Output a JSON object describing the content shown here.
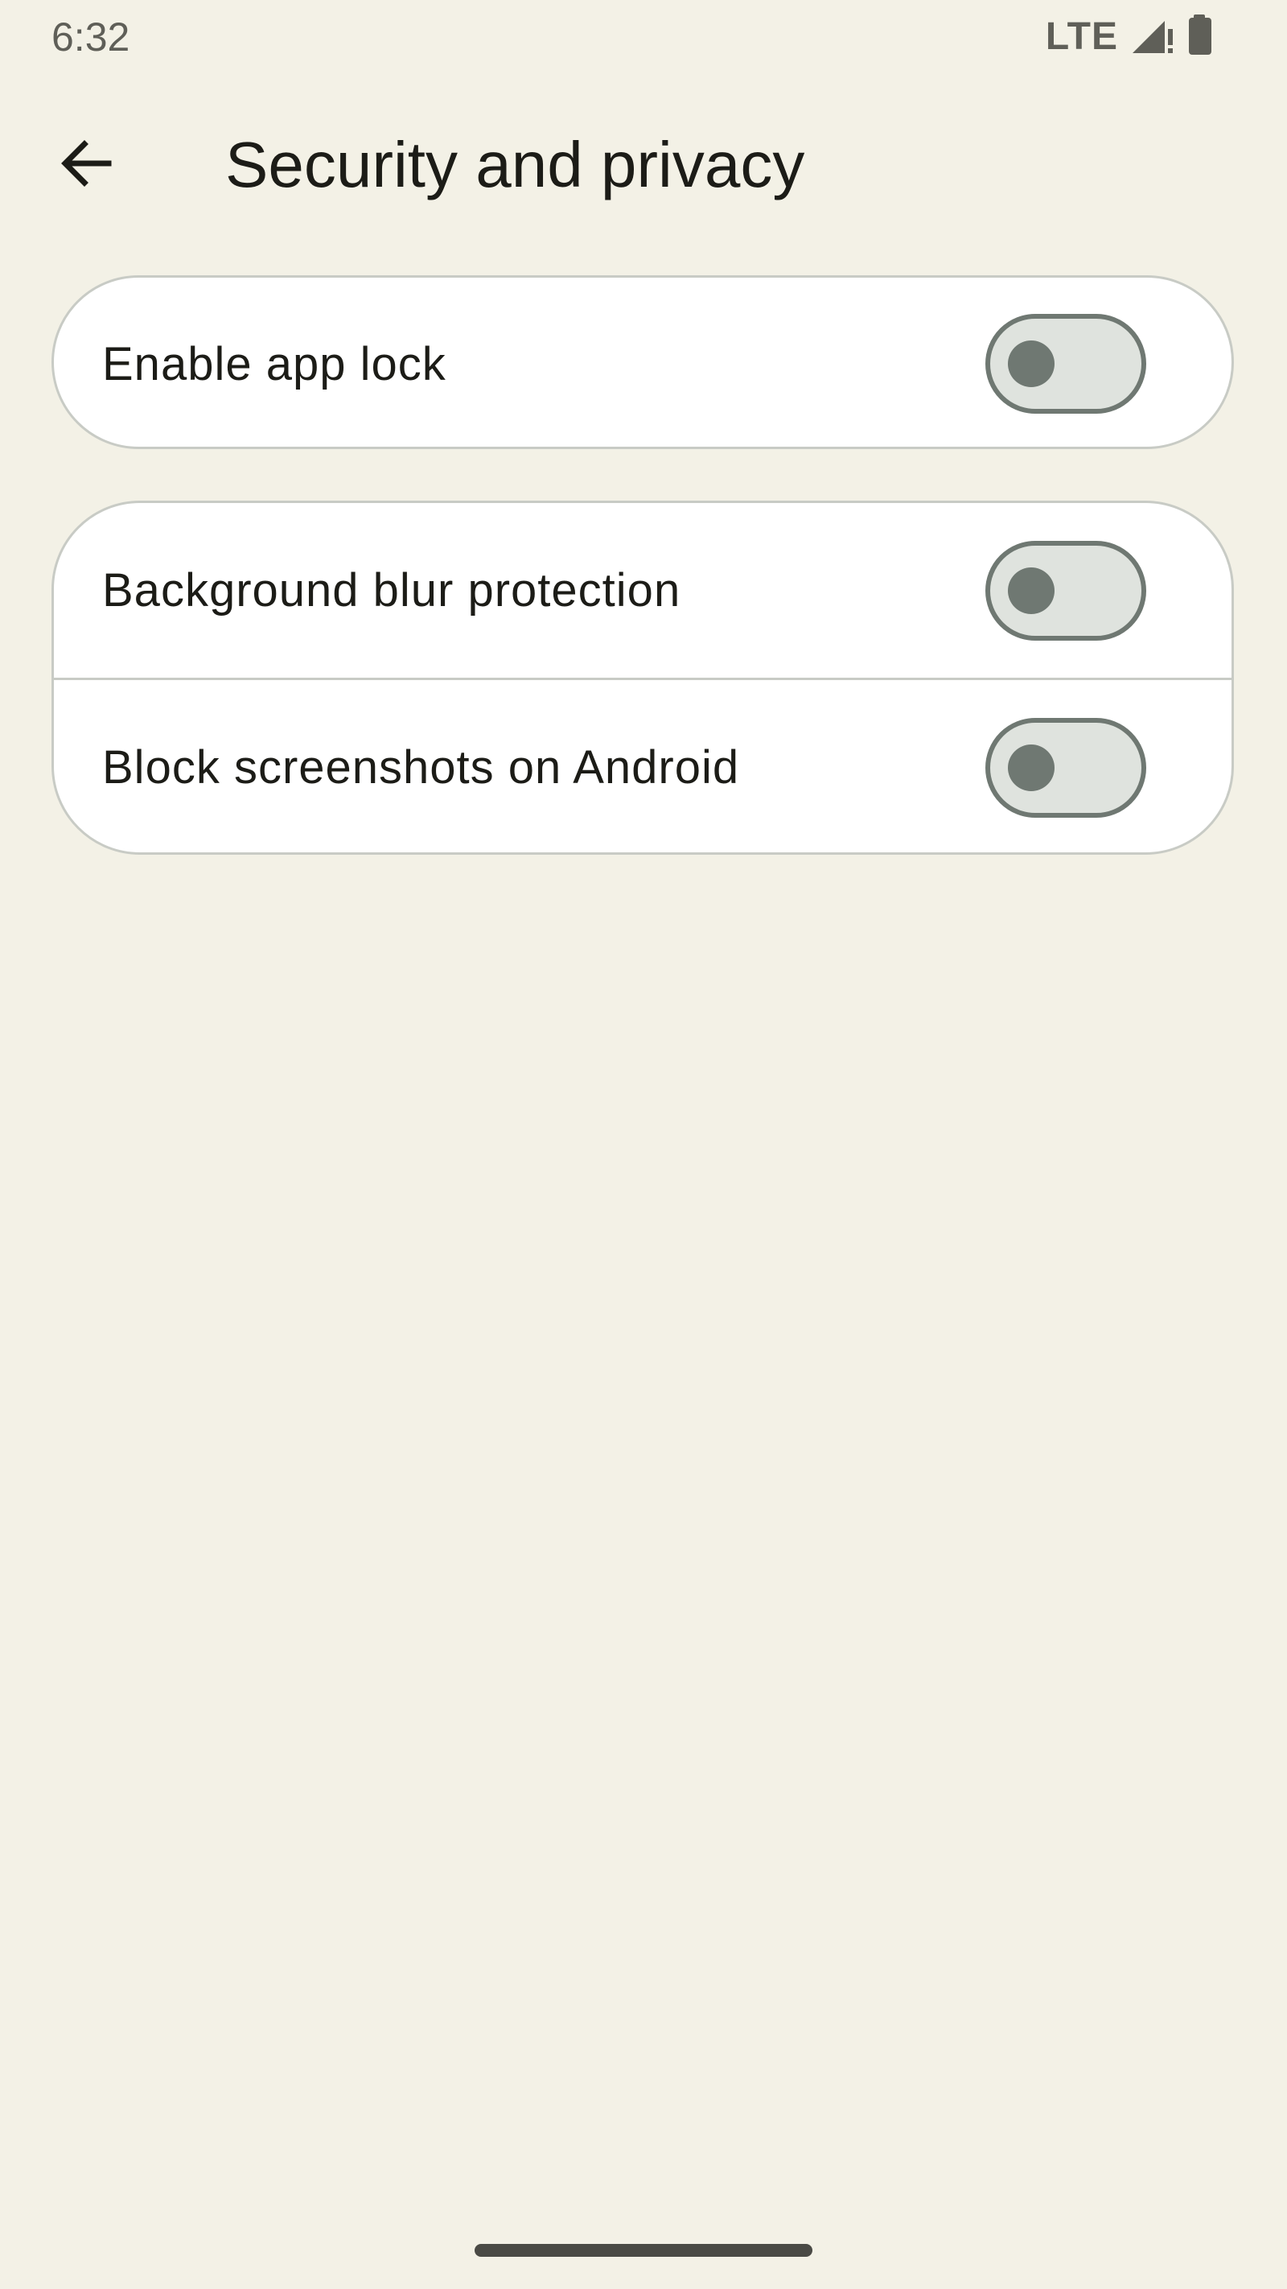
{
  "status_bar": {
    "time": "6:32",
    "network": "LTE",
    "signal_icon": "signal-alert-icon",
    "battery_icon": "battery-icon"
  },
  "app_bar": {
    "back_icon": "arrow-back-icon",
    "title": "Security and privacy"
  },
  "settings": {
    "app_lock": {
      "label": "Enable app lock",
      "enabled": false
    },
    "background_blur": {
      "label": "Background blur protection",
      "enabled": false
    },
    "block_screenshots": {
      "label": "Block screenshots on Android",
      "enabled": false
    }
  },
  "colors": {
    "background": "#f3f1e6",
    "card": "#ffffff",
    "switch_track": "#dfe3de",
    "switch_outline": "#6f7872"
  }
}
